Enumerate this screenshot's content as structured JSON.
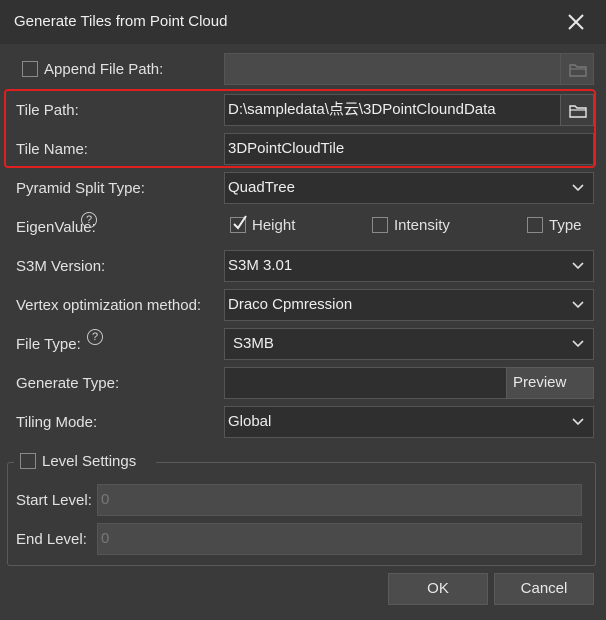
{
  "dialog": {
    "title": "Generate Tiles from Point Cloud"
  },
  "append_file_path": {
    "label": "Append File Path:",
    "checked": false,
    "value": ""
  },
  "tile_path": {
    "label": "Tile Path:",
    "value": "D:\\sampledata\\点云\\3DPointCloundData"
  },
  "tile_name": {
    "label": "Tile Name:",
    "value": "3DPointCloudTile"
  },
  "pyramid_split_type": {
    "label": "Pyramid Split Type:",
    "value": "QuadTree"
  },
  "eigen_value": {
    "label": "EigenValue:",
    "options": [
      {
        "label": "Height",
        "checked": true
      },
      {
        "label": "Intensity",
        "checked": false
      },
      {
        "label": "Type",
        "checked": false
      }
    ]
  },
  "s3m_version": {
    "label": "S3M Version:",
    "value": "S3M 3.01"
  },
  "vertex_optimization": {
    "label": "Vertex optimization method:",
    "value": "Draco Cpmression"
  },
  "file_type": {
    "label": "File Type:",
    "value": "S3MB"
  },
  "generate_type": {
    "label": "Generate Type:",
    "value": "",
    "preview_label": "Preview"
  },
  "tiling_mode": {
    "label": "Tiling Mode:",
    "value": "Global"
  },
  "level_settings": {
    "label": "Level Settings",
    "checked": false,
    "start_level": {
      "label": "Start Level:",
      "value": "0"
    },
    "end_level": {
      "label": "End Level:",
      "value": "0"
    }
  },
  "buttons": {
    "ok": "OK",
    "cancel": "Cancel"
  },
  "icons": {
    "close": "close-icon",
    "folder": "folder-icon",
    "help": "help-icon",
    "chevron": "chevron-down-icon"
  },
  "colors": {
    "highlight": "#e02020",
    "background": "#3a3a3a"
  }
}
